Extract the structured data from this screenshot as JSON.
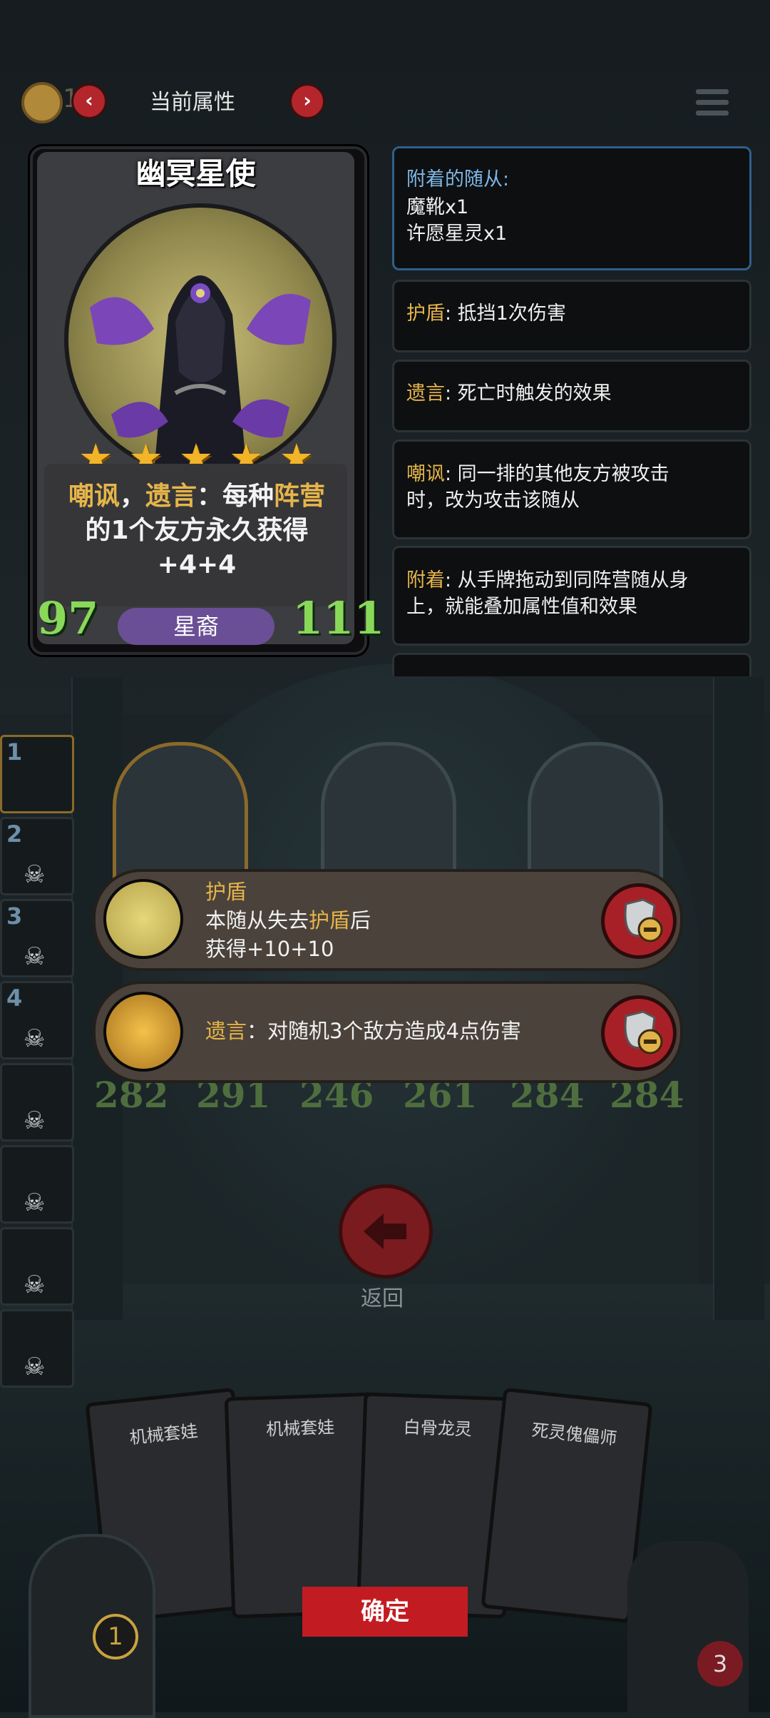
{
  "top_bar": {
    "coin_text": "1 3",
    "title": "当前属性",
    "prev_icon": "chevron-left-icon",
    "next_icon": "chevron-right-icon"
  },
  "hero_card": {
    "name": "幽冥星使",
    "stars": 5,
    "desc_kw1": "嘲讽",
    "desc_sep1": "，",
    "desc_kw2": "遗言",
    "desc_mid": "：每种",
    "desc_kw3": "阵营",
    "desc_line2": "的1个友方永久获得",
    "desc_line3": "+4+4",
    "attack": "97",
    "health": "111",
    "tribe": "星裔"
  },
  "info_panels": {
    "attached_title": "附着的随从:",
    "attached_items": [
      "魔靴x1",
      "许愿星灵x1"
    ],
    "shield_key": "护盾",
    "shield_text": ": 抵挡1次伤害",
    "deathrattle_key": "遗言",
    "deathrattle_text": ": 死亡时触发的效果",
    "taunt_key": "嘲讽",
    "taunt_text_1": ": 同一排的其他友方被攻击",
    "taunt_text_2": "时，改为攻击该随从",
    "attach_key": "附着",
    "attach_text_1": ": 从手牌拖动到同阵营随从身",
    "attach_text_2": "上，就能叠加属性值和效果"
  },
  "team_slots": [
    "1",
    "2",
    "3",
    "4"
  ],
  "battlefield": {
    "stats": [
      {
        "atk": "282",
        "hp": "291"
      },
      {
        "atk": "246",
        "hp": "261"
      },
      {
        "atk": "284",
        "hp": "284"
      }
    ]
  },
  "effects": [
    {
      "title": "护盾",
      "line1_a": "本随从失去",
      "line1_kw": "护盾",
      "line1_b": "后",
      "line2": "获得+10+10"
    },
    {
      "kw": "遗言",
      "text": "：对随机3个敌方造成4点伤害"
    }
  ],
  "back_label": "返回",
  "hand_cards": [
    "机械套娃",
    "机械套娃",
    "白骨龙灵",
    "死灵傀儡师"
  ],
  "confirm_label": "确定",
  "bottom": {
    "coin_count": "1",
    "heart_count": "3"
  },
  "colors": {
    "keyword": "#e6b54a",
    "attack": "#8ad85a",
    "confirm": "#c21c22"
  }
}
